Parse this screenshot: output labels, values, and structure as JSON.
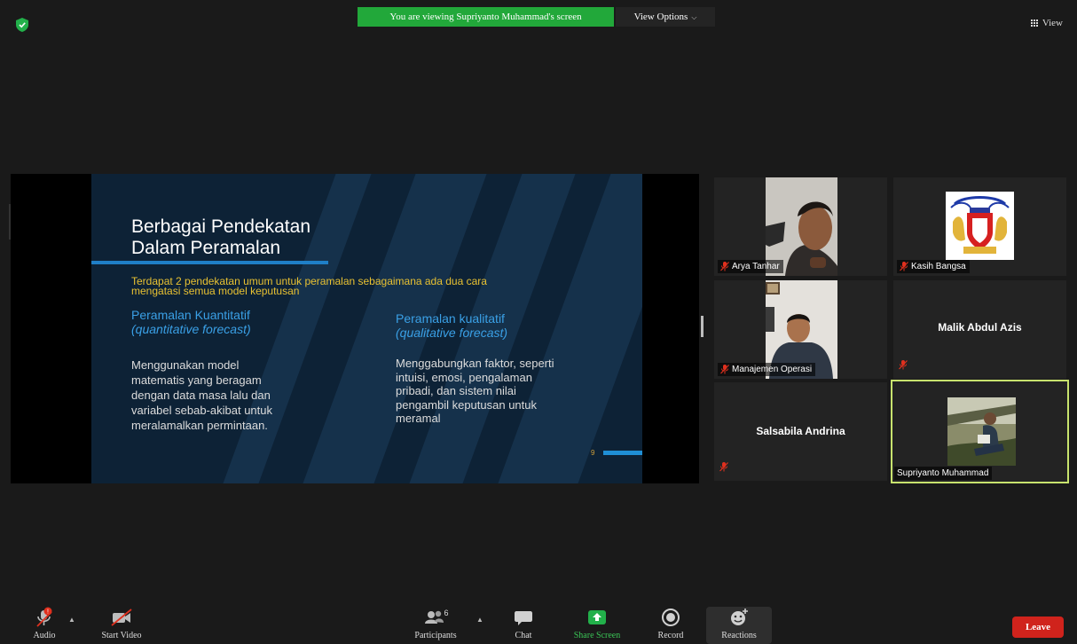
{
  "top_bar": {
    "viewing_banner": "You are viewing Supriyanto Muhammad's screen",
    "view_options": "View Options",
    "view": "View"
  },
  "slide": {
    "title_line1": "Berbagai Pendekatan",
    "title_line2": "Dalam Peramalan",
    "intro_line1": "Terdapat 2 pendekatan umum untuk peramalan sebagaimana ada dua cara",
    "intro_line2": "mengatasi semua model keputusan",
    "left_head": "Peramalan Kuantitatif",
    "left_sub": "(quantitative forecast)",
    "left_body": [
      "Menggunakan model",
      "matematis yang beragam",
      "dengan data masa lalu dan",
      "variabel sebab-akibat untuk",
      "meralamalkan permintaan."
    ],
    "right_head": "Peramalan kualitatif",
    "right_sub": "(qualitative forecast)",
    "right_body": [
      "Menggabungkan faktor, seperti",
      "intuisi, emosi, pengalaman",
      "pribadi, dan sistem nilai",
      "pengambil keputusan untuk",
      "meramal"
    ],
    "page_number": "9"
  },
  "participants": {
    "arya": "Arya Tanhar",
    "kasih": "Kasih Bangsa",
    "manajemen": "Manajemen Operasi",
    "malik": "Malik Abdul Azis",
    "salsabila": "Salsabila Andrina",
    "supriyanto": "Supriyanto Muhammad"
  },
  "toolbar": {
    "audio": "Audio",
    "audio_badge": "!",
    "start_video": "Start Video",
    "participants": "Participants",
    "participants_count": "6",
    "chat": "Chat",
    "share_screen": "Share Screen",
    "record": "Record",
    "reactions": "Reactions",
    "leave": "Leave"
  },
  "colors": {
    "banner_green": "#22a83a",
    "active_speaker_border": "#c8e36e",
    "leave_red": "#d0231c",
    "slide_accent_blue": "#3aa0e6",
    "slide_intro_yellow": "#e8c132"
  }
}
